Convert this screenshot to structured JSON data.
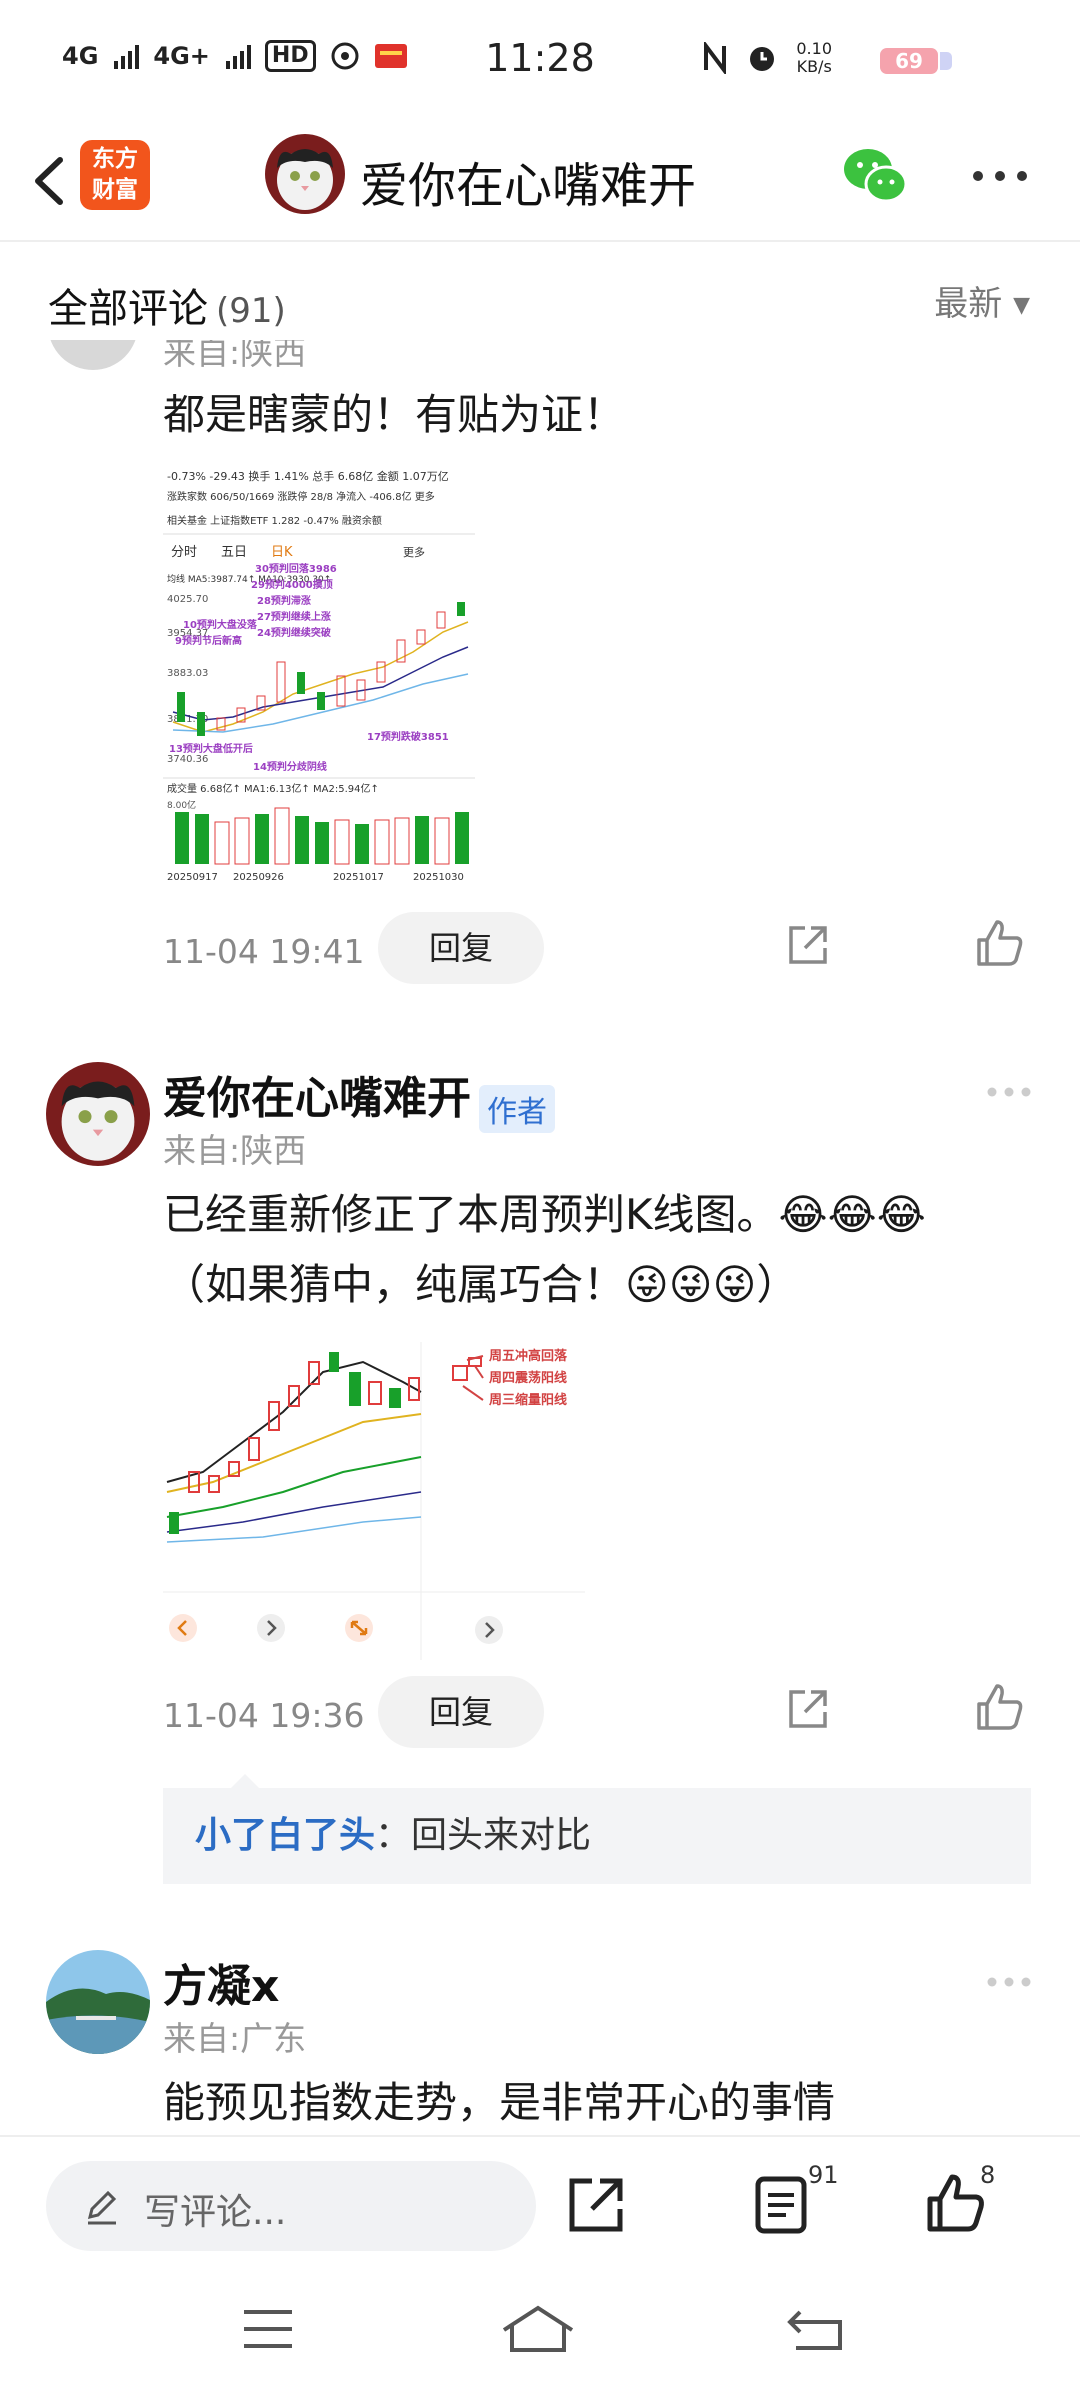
{
  "status_bar": {
    "network1": "4G",
    "network2": "4G+",
    "hd": "HD",
    "time": "11:28",
    "net_speed": "0.10",
    "net_unit": "KB/s",
    "battery": "69"
  },
  "nav": {
    "app_logo_line1": "东方",
    "app_logo_line2": "财富",
    "title": "爱你在心嘴难开"
  },
  "comments_header": {
    "title": "全部评论",
    "count": "(91)",
    "sort": "最新"
  },
  "comments": [
    {
      "partial_top": "来自:陕西",
      "text": "都是瞎蒙的！有贴为证！",
      "time": "11-04 19:41",
      "reply_label": "回复",
      "image_labels": {
        "top1": "-0.73%  -29.43  换手 1.41%  总手 6.68亿  金额 1.07万亿",
        "top2": "涨跌家数 606/50/1669  涨跌停 28/8  净流入 -406.8亿  更多",
        "top3": "相关基金  上证指数ETF 1.282 -0.47%  融资余额",
        "tabs": [
          "分时",
          "五日",
          "日K",
          "更多"
        ],
        "ma": "均线  MA5:3987.74↑  MA10:3930.30↑",
        "price_top": "4025.70",
        "price_2": "3954.37",
        "price_3": "3883.03",
        "price_4": "3811.70",
        "price_bot": "3740.36",
        "vol": "成交量  6.68亿↑  MA1:6.13亿↑  MA2:5.94亿↑",
        "vol_val": "8.00亿",
        "dates": [
          "20250917",
          "20250926",
          "20251017",
          "20251030"
        ],
        "notes": [
          "30预判回落3986",
          "29预判4000摸顶",
          "28预判滞涨",
          "27预判继续上涨",
          "24预判继续突破",
          "10预判大盘没落",
          "9预判节后新高",
          "13预判大盘低开后",
          "14预判分歧阴线",
          "17预判跌破3851"
        ]
      }
    },
    {
      "user": "爱你在心嘴难开",
      "badge": "作者",
      "location": "来自:陕西",
      "text_line1": "已经重新修正了本周预判K线图。😂😂😂",
      "text_line2": "（如果猜中，纯属巧合！😜😜😜）",
      "time": "11-04 19:36",
      "reply_label": "回复",
      "image_labels": {
        "note1": "周五冲高回落",
        "note2": "周四震荡阳线",
        "note3": "周三缩量阳线"
      },
      "sub_reply": {
        "user": "小了白了头",
        "text": "：回头来对比"
      }
    },
    {
      "user": "方凝x",
      "location": "来自:广东",
      "text": "能预见指数走势，是非常开心的事情"
    }
  ],
  "bottom_bar": {
    "write_placeholder": "写评论...",
    "comment_count": "91",
    "like_count": "8"
  },
  "colors": {
    "app_orange": "#f2551c",
    "candle_green": "#18a02a",
    "candle_red": "#e03c3c",
    "link_blue": "#2b6cc4"
  }
}
